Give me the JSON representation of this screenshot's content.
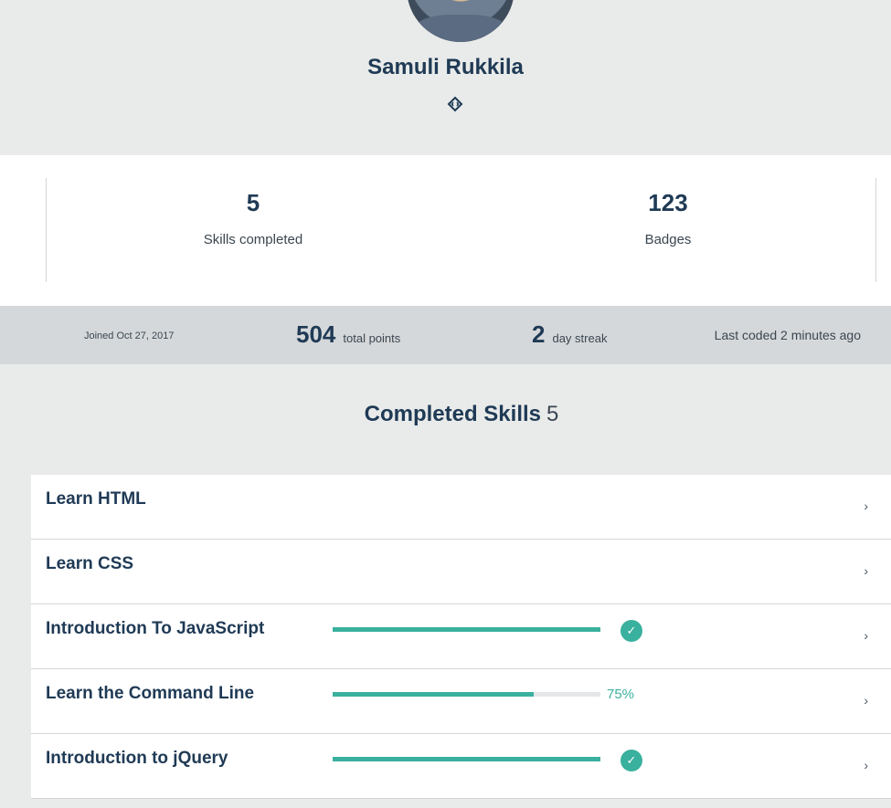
{
  "profile": {
    "name": "Samuli Rukkila",
    "avatar_icon": "user-avatar-photo",
    "code_icon": "code-diamond-icon"
  },
  "stats": {
    "skills_completed_value": "5",
    "skills_completed_label": "Skills completed",
    "badges_value": "123",
    "badges_label": "Badges"
  },
  "summary": {
    "joined": "Joined Oct 27, 2017",
    "points_value": "504",
    "points_label": "total points",
    "streak_value": "2",
    "streak_label": "day streak",
    "last_coded": "Last coded 2 minutes ago"
  },
  "completed_skills": {
    "heading": "Completed Skills",
    "count": "5",
    "items": [
      {
        "title": "Learn HTML",
        "progress": null,
        "status": "none"
      },
      {
        "title": "Learn CSS",
        "progress": null,
        "status": "none"
      },
      {
        "title": "Introduction To JavaScript",
        "progress": 1.0,
        "status": "complete"
      },
      {
        "title": "Learn the Command Line",
        "progress": 0.75,
        "status": "percent",
        "percent_label": "75%"
      },
      {
        "title": "Introduction to jQuery",
        "progress": 1.0,
        "status": "complete"
      }
    ]
  },
  "colors": {
    "accent": "#3ab09e",
    "heading": "#1f3a55"
  }
}
